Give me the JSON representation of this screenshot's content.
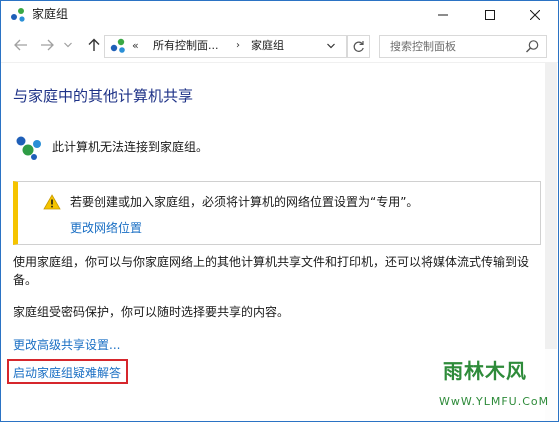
{
  "window": {
    "title": "家庭组",
    "accent": "#2b73c4"
  },
  "nav": {
    "breadcrumb_chevron": "«",
    "crumbs": [
      "所有控制面...",
      "家庭组"
    ],
    "separator": "›",
    "search_placeholder": "搜索控制面板"
  },
  "content": {
    "heading": "与家庭中的其他计算机共享",
    "status": "此计算机无法连接到家庭组。",
    "warning": {
      "text": "若要创建或加入家庭组，必须将计算机的网络位置设置为“专用”。",
      "link": "更改网络位置",
      "accent": "#f5c400"
    },
    "description": "使用家庭组，你可以与你家庭网络上的其他计算机共享文件和打印机，还可以将媒体流式传输到设备。",
    "password_note": "家庭组受密码保护，你可以随时选择要共享的内容。",
    "links": {
      "advanced_sharing": "更改高级共享设置...",
      "troubleshooter": "启动家庭组疑难解答"
    },
    "highlight_color": "#d6262c",
    "link_color": "#1a6fc4",
    "heading_color": "#1e3287"
  },
  "watermark": {
    "logo_text": "雨林木风",
    "url": "WwW.YLMFU.CoM"
  },
  "icons": {
    "title": "homegroup-icon",
    "back": "arrow-left-icon",
    "forward": "arrow-right-icon",
    "recent": "chevron-down-icon",
    "up": "arrow-up-icon",
    "refresh": "refresh-icon",
    "search": "search-icon",
    "warning": "warning-icon"
  }
}
